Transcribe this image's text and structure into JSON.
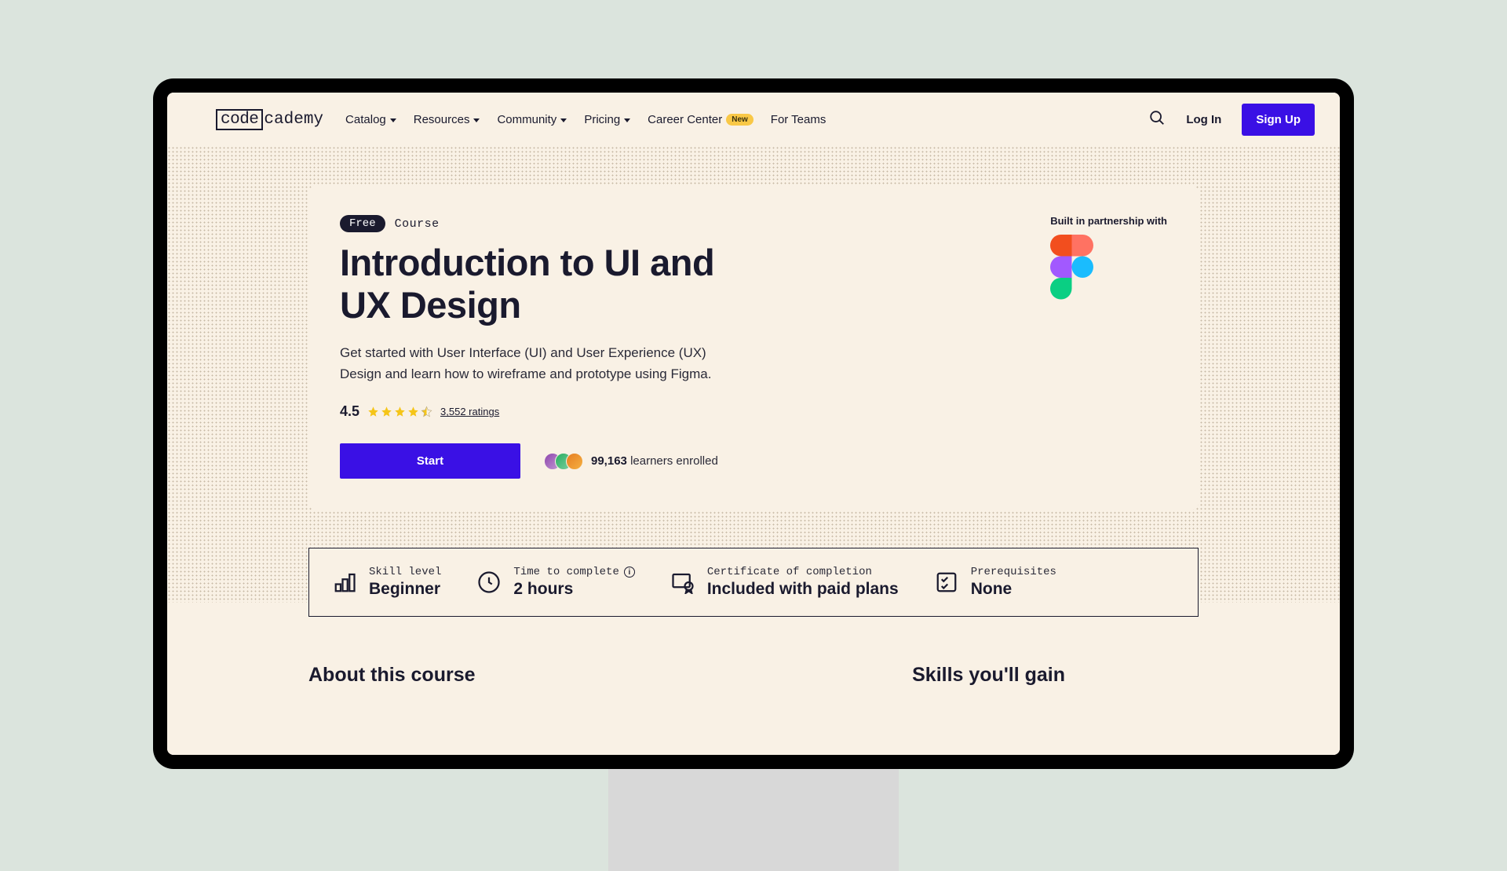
{
  "nav": {
    "logo_boxed": "code",
    "logo_rest": "cademy",
    "items": [
      {
        "label": "Catalog",
        "hasCaret": true
      },
      {
        "label": "Resources",
        "hasCaret": true
      },
      {
        "label": "Community",
        "hasCaret": true
      },
      {
        "label": "Pricing",
        "hasCaret": true
      },
      {
        "label": "Career Center",
        "hasCaret": false,
        "badge": "New"
      },
      {
        "label": "For Teams",
        "hasCaret": false
      }
    ],
    "login": "Log In",
    "signup": "Sign Up"
  },
  "hero": {
    "free_badge": "Free",
    "course_type": "Course",
    "title": "Introduction to UI and UX Design",
    "description": "Get started with User Interface (UI) and User Experience (UX) Design and learn how to wireframe and prototype using Figma.",
    "rating": "4.5",
    "ratings_count": "3,552 ratings",
    "start_label": "Start",
    "learners_count": "99,163",
    "learners_suffix": "learners enrolled",
    "partner_label": "Built in partnership with"
  },
  "stats": {
    "skill_level": {
      "label": "Skill level",
      "value": "Beginner"
    },
    "time": {
      "label": "Time to complete",
      "value": "2 hours"
    },
    "certificate": {
      "label": "Certificate of completion",
      "value": "Included with paid plans"
    },
    "prereq": {
      "label": "Prerequisites",
      "value": "None"
    }
  },
  "sections": {
    "about": "About this course",
    "skills": "Skills you'll gain"
  },
  "colors": {
    "primary": "#3a10e5",
    "figma": {
      "red": "#f24e1e",
      "orange": "#ff7262",
      "purple": "#a259ff",
      "blue": "#1abcfe",
      "green": "#0acf83"
    }
  }
}
